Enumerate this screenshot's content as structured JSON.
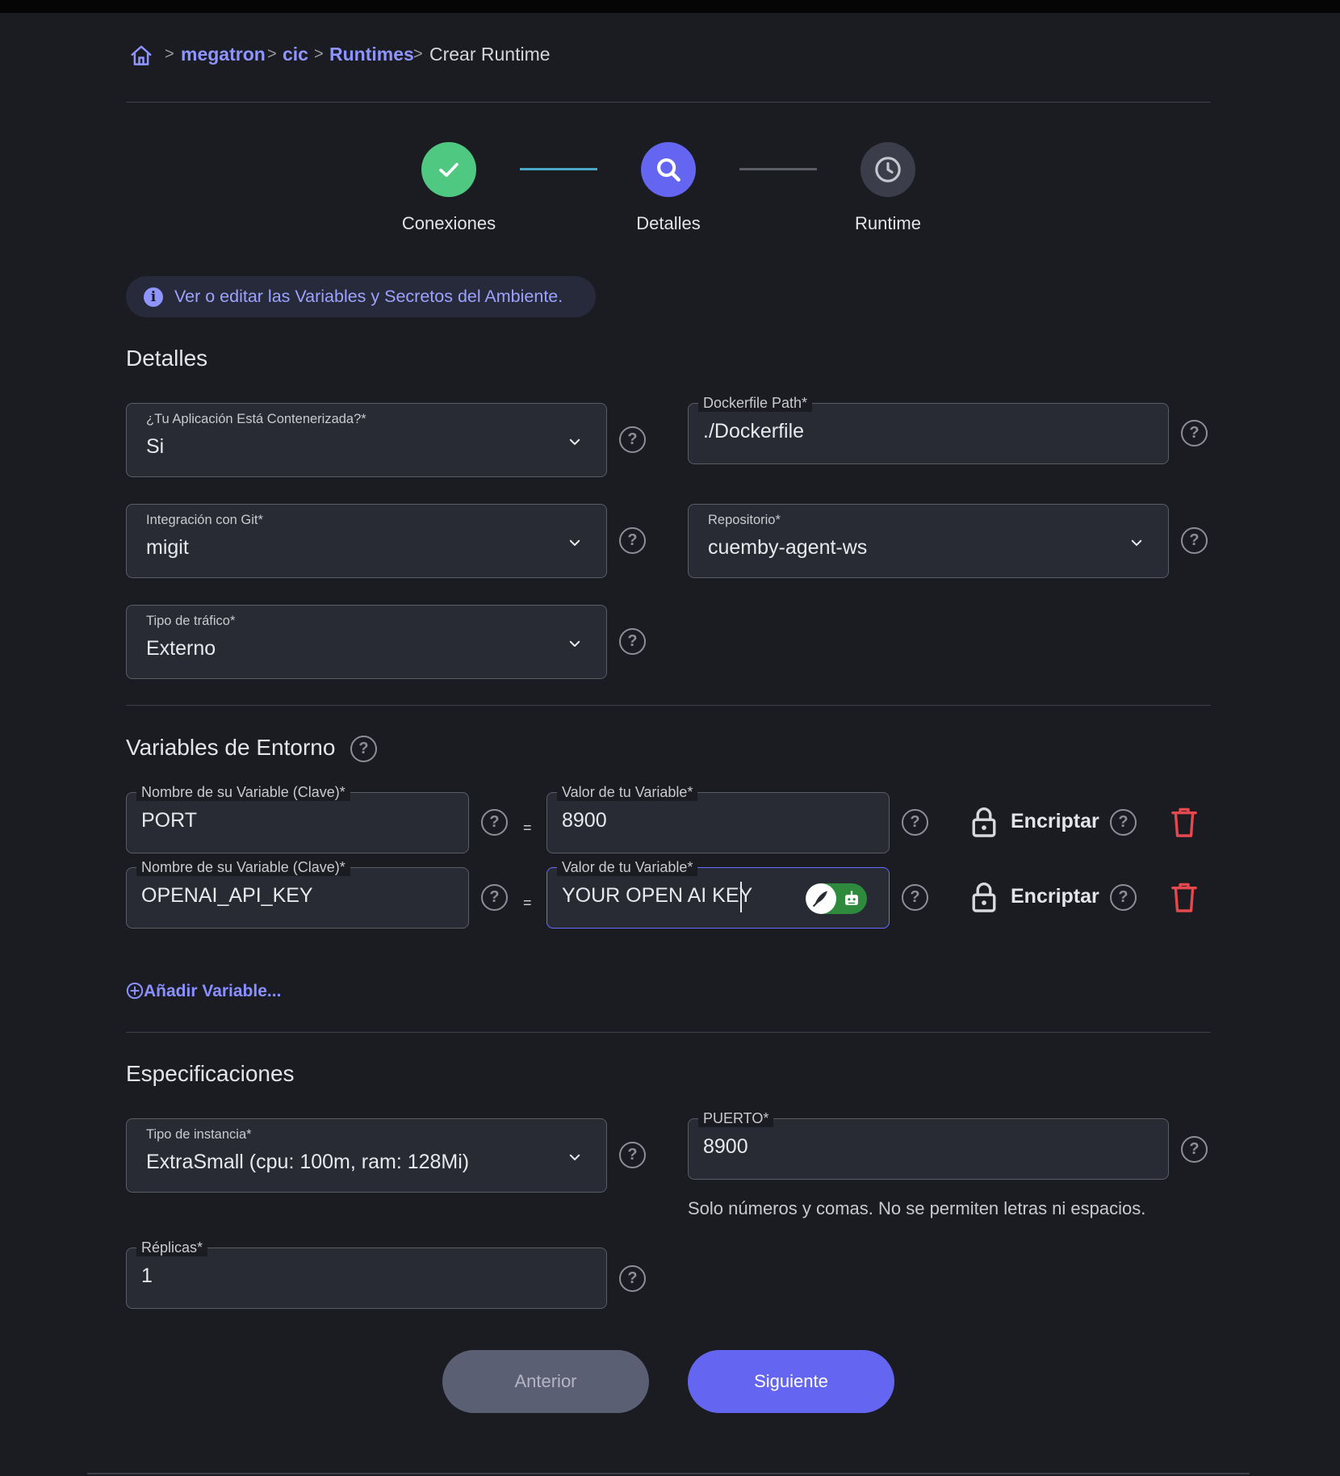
{
  "breadcrumb": {
    "items": [
      "megatron",
      "cic",
      "Runtimes"
    ],
    "current": "Crear Runtime",
    "separator": ">"
  },
  "stepper": {
    "steps": [
      {
        "label": "Conexiones",
        "state": "completed",
        "icon": "check-icon"
      },
      {
        "label": "Detalles",
        "state": "active",
        "icon": "search-icon"
      },
      {
        "label": "Runtime",
        "state": "pending",
        "icon": "clock-icon"
      }
    ]
  },
  "info_link": "Ver o editar las Variables y Secretos del Ambiente.",
  "details": {
    "title": "Detalles",
    "containerized": {
      "label": "¿Tu Aplicación Está Contenerizada?*",
      "value": "Si"
    },
    "dockerfile": {
      "label": "Dockerfile Path*",
      "value": "./Dockerfile"
    },
    "git": {
      "label": "Integración con Git*",
      "value": "migit"
    },
    "repo": {
      "label": "Repositorio*",
      "value": "cuemby-agent-ws"
    },
    "traffic": {
      "label": "Tipo de tráfico*",
      "value": "Externo"
    }
  },
  "env": {
    "title": "Variables de Entorno",
    "rows": [
      {
        "key_label": "Nombre de su Variable (Clave)*",
        "key": "PORT",
        "eq": "=",
        "value_label": "Valor de tu Variable*",
        "value": "8900",
        "encrypt": "Encriptar"
      },
      {
        "key_label": "Nombre de su Variable (Clave)*",
        "key": "OPENAI_API_KEY",
        "eq": "=",
        "value_label": "Valor de tu Variable*",
        "value": "YOUR OPEN AI KEY",
        "encrypt": "Encriptar"
      }
    ],
    "add": "Añadir Variable..."
  },
  "specs": {
    "title": "Especificaciones",
    "instance": {
      "label": "Tipo de instancia*",
      "value": "ExtraSmall (cpu: 100m, ram: 128Mi)"
    },
    "port": {
      "label": "PUERTO*",
      "value": "8900",
      "hint": "Solo números y comas. No se permiten letras ni espacios."
    },
    "replicas": {
      "label": "Réplicas*",
      "value": "1"
    }
  },
  "buttons": {
    "previous": "Anterior",
    "next": "Siguiente"
  },
  "colors": {
    "background": "#1b1c21",
    "accent": "#6466f1",
    "link": "#8f95ff",
    "success": "#4fc882",
    "danger": "#e5484d"
  }
}
